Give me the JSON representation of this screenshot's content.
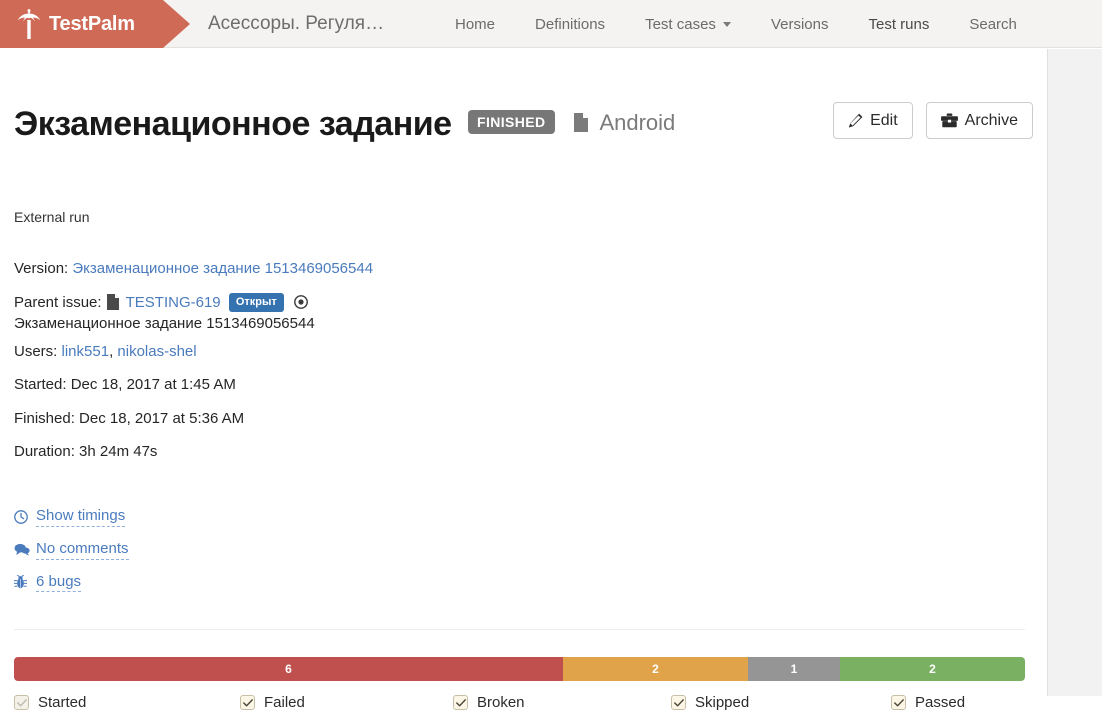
{
  "navbar": {
    "brand_name": "TestPalm",
    "brand_icon": "palm-tree-icon",
    "project_title": "Асессоры. Регуля…",
    "links": [
      {
        "label": "Home",
        "icon": null
      },
      {
        "label": "Definitions",
        "icon": null
      },
      {
        "label": "Test cases",
        "icon": "chevron-down-icon"
      },
      {
        "label": "Versions",
        "icon": null
      },
      {
        "label": "Test runs",
        "icon": null
      },
      {
        "label": "Search",
        "icon": null
      }
    ]
  },
  "header": {
    "page_title": "Экзаменационное задание",
    "status_badge": "FINISHED",
    "platform": "Android",
    "platform_icon": "file-icon",
    "subtitle": "External run",
    "edit_label": "Edit",
    "edit_icon": "pencil-icon",
    "archive_label": "Archive",
    "archive_icon": "briefcase-icon"
  },
  "meta": {
    "version_label": "Version:",
    "version_value": "Экзаменационное задание 1513469056544",
    "parent_issue_label": "Parent issue:",
    "parent_issue_key": "TESTING-619",
    "parent_issue_status": "Открыт",
    "parent_issue_title": "Экзаменационное задание 1513469056544",
    "users_label": "Users:",
    "users": [
      "link551",
      "nikolas-shel"
    ],
    "users_separator": ", ",
    "started_label": "Started:",
    "started_value": "Dec 18, 2017 at 1:45 AM",
    "finished_label": "Finished:",
    "finished_value": "Dec 18, 2017 at 5:36 AM",
    "duration_label": "Duration:",
    "duration_value": "3h 24m 47s"
  },
  "links": [
    {
      "label": "Show timings",
      "icon": "clock-icon"
    },
    {
      "label": "No comments",
      "icon": "comments-icon"
    },
    {
      "label": "6 bugs",
      "icon": "bug-icon"
    }
  ],
  "chart_data": {
    "type": "bar",
    "title": "",
    "orientation": "horizontal-stacked",
    "categories": [
      "Failed",
      "Skipped",
      "Broken",
      "Passed"
    ],
    "values": [
      6,
      2,
      1,
      2
    ],
    "labels": [
      "6",
      "2",
      "1",
      "2"
    ],
    "colors": [
      "#c0504d",
      "#e0a34a",
      "#959595",
      "#79b062"
    ],
    "total": 11,
    "xlabel": "",
    "ylabel": ""
  },
  "legend": {
    "items": [
      {
        "label": "Started",
        "checked": true,
        "dim": true
      },
      {
        "label": "Failed",
        "checked": true,
        "dim": false
      },
      {
        "label": "Broken",
        "checked": true,
        "dim": false
      },
      {
        "label": "Skipped",
        "checked": true,
        "dim": false
      },
      {
        "label": "Passed",
        "checked": true,
        "dim": false
      }
    ]
  },
  "colors": {
    "brand": "#cf6a56",
    "link": "#4a7bbd",
    "badge_finished": "#777777",
    "badge_open": "#3572b0"
  }
}
